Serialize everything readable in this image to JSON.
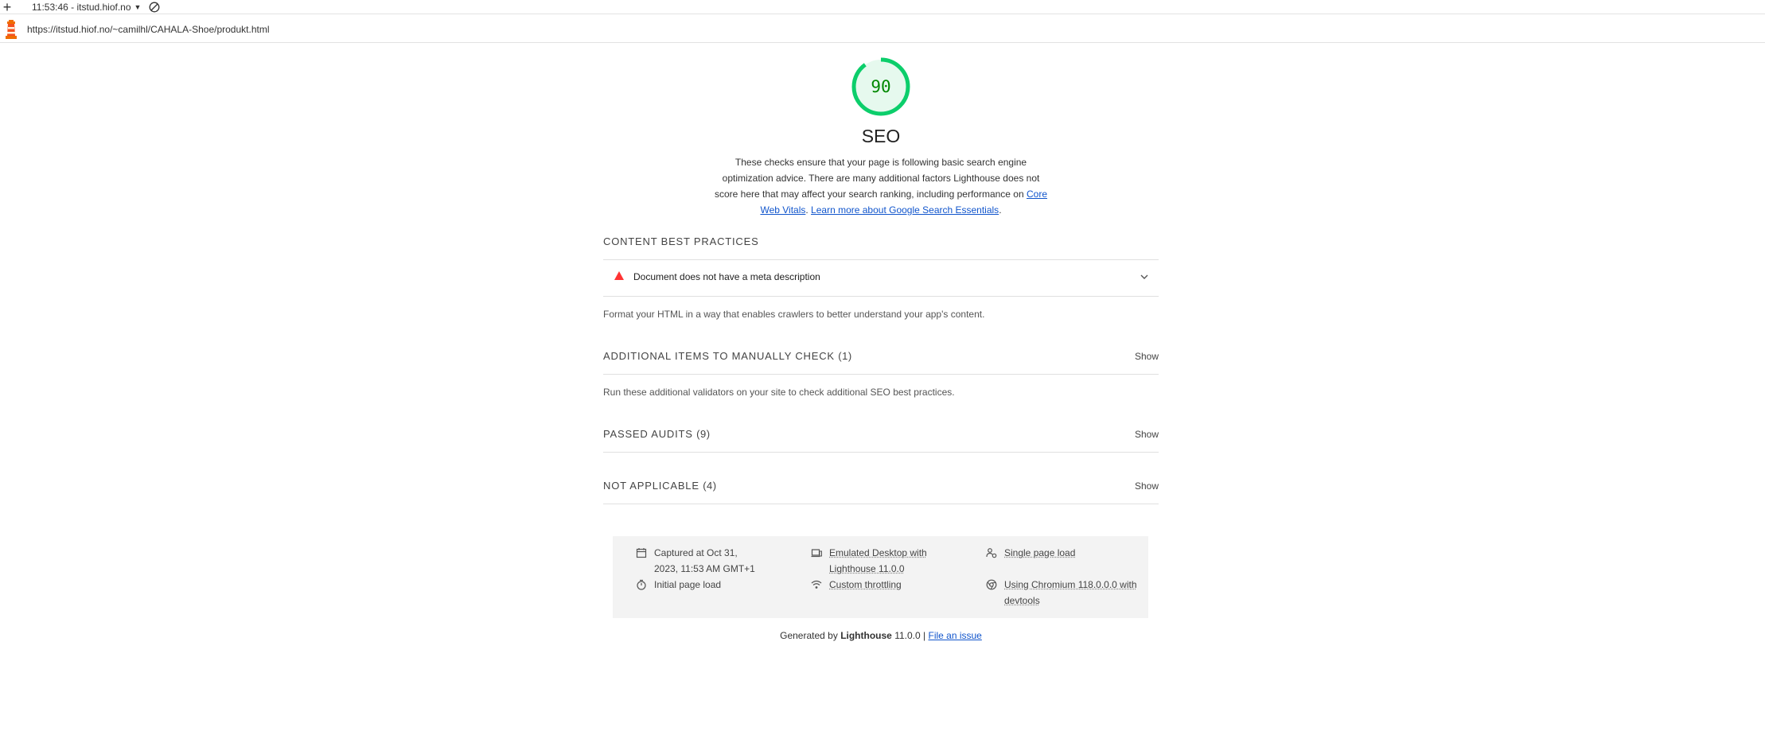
{
  "topbar": {
    "new_tab": "+",
    "session_label": "11:53:46 - itstud.hiof.no"
  },
  "urlbar": {
    "url": "https://itstud.hiof.no/~camilhl/CAHALA-Shoe/produkt.html"
  },
  "category": {
    "score": "90",
    "score_fraction": 0.9,
    "title": "SEO",
    "description": "These checks ensure that your page is following basic search engine optimization advice. There are many additional factors Lighthouse does not score here that may affect your search ranking, including performance on",
    "link_cwv": "Core Web Vitals",
    "sep": ". ",
    "link_learn": "Learn more about Google Search Essentials",
    "end": "."
  },
  "groups": {
    "content": {
      "title": "Content Best Practices",
      "audit_title": "Document does not have a meta description",
      "description": "Format your HTML in a way that enables crawlers to better understand your app's content."
    },
    "manual": {
      "title": "Additional items to manually check",
      "count": "(1)",
      "show": "Show",
      "description": "Run these additional validators on your site to check additional SEO best practices."
    },
    "passed": {
      "title": "Passed audits",
      "count": "(9)",
      "show": "Show"
    },
    "na": {
      "title": "Not applicable",
      "count": "(4)",
      "show": "Show"
    }
  },
  "env": {
    "captured": "Captured at Oct 31, 2023, 11:53 AM GMT+1",
    "initial": "Initial page load",
    "emulated": "Emulated Desktop with Lighthouse 11.0.0",
    "throttling": "Custom throttling",
    "single": "Single page load",
    "chromium": "Using Chromium 118.0.0.0 with devtools"
  },
  "footer": {
    "generated_by": "Generated by",
    "product": "Lighthouse",
    "version": "11.0.0 |",
    "file_issue": "File an issue"
  },
  "colors": {
    "pass": "#0cce6b",
    "pass_text": "#008800",
    "fail": "#ff3333",
    "link": "#1155cc"
  }
}
